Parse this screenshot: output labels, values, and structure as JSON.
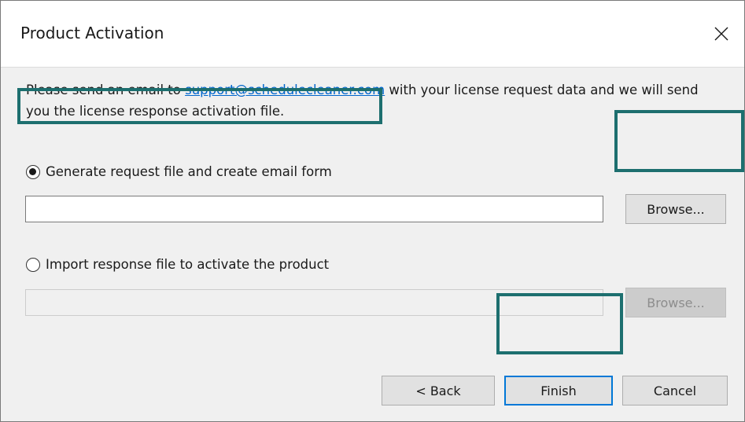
{
  "window": {
    "title": "Product Activation"
  },
  "message": {
    "before": "Please send an email to ",
    "link": "support@schedulecleaner.com",
    "after": " with your license request data and we will send you the license response activation file."
  },
  "options": {
    "generate": {
      "label": "Generate request file and create email form",
      "selected": true,
      "path_value": "",
      "browse_label": "Browse..."
    },
    "import": {
      "label": "Import response file to activate the product",
      "selected": false,
      "path_value": "",
      "browse_label": "Browse..."
    }
  },
  "buttons": {
    "back": "< Back",
    "finish": "Finish",
    "cancel": "Cancel"
  },
  "colors": {
    "highlight": "#1d6f6f",
    "link": "#0066cc",
    "focus": "#0078d7"
  }
}
